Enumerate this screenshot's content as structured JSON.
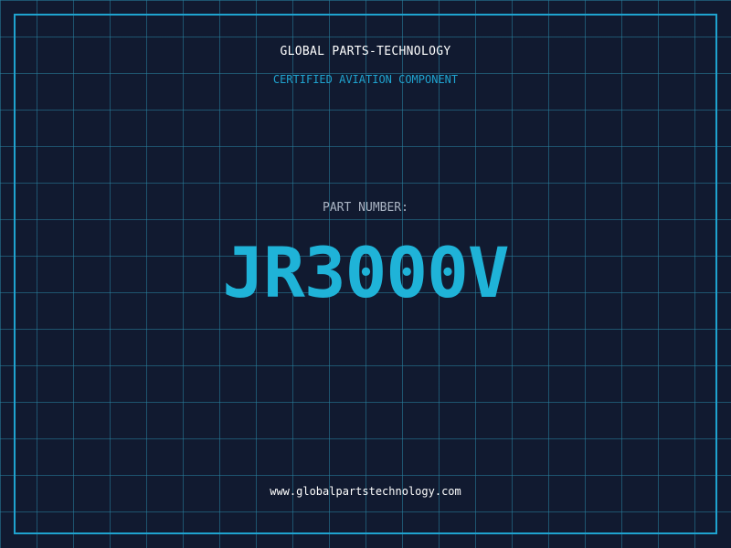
{
  "header": {
    "company": "GLOBAL PARTS-TECHNOLOGY",
    "tagline": "CERTIFIED AVIATION COMPONENT"
  },
  "part": {
    "label": "PART NUMBER:",
    "number": "JR3000V"
  },
  "footer": {
    "website": "www.globalpartstechnology.com"
  },
  "colors": {
    "background": "#111a30",
    "accent": "#1fa3cf",
    "grid": "#28829f"
  }
}
